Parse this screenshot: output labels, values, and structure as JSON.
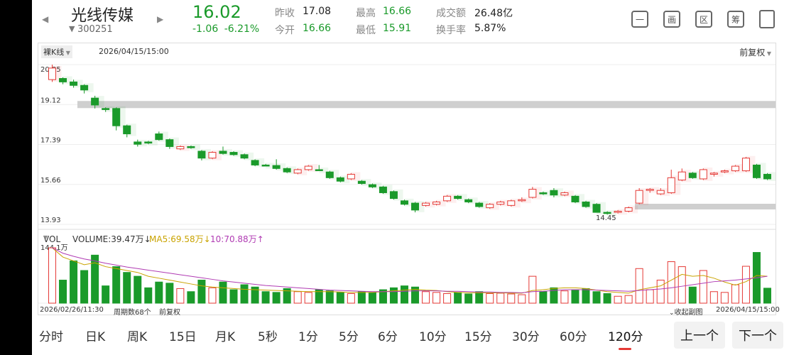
{
  "header": {
    "name": "光线传媒",
    "code": "300251",
    "price": "16.02",
    "change": "-1.06",
    "change_pct": "-6.21%",
    "stats": [
      {
        "label": "昨收",
        "value": "17.08",
        "color": "dark"
      },
      {
        "label": "今开",
        "value": "16.66",
        "color": "green"
      },
      {
        "label": "最高",
        "value": "16.66",
        "color": "green"
      },
      {
        "label": "最低",
        "value": "15.91",
        "color": "green"
      },
      {
        "label": "成交额",
        "value": "26.48亿",
        "color": "dark"
      },
      {
        "label": "换手率",
        "value": "5.87%",
        "color": "dark"
      }
    ],
    "tools": [
      "一",
      "画",
      "区",
      "筹"
    ]
  },
  "chart_top": {
    "mode": "裸K线",
    "timestamp": "2026/04/15/15:00",
    "adjust": "前复权"
  },
  "vol_info": {
    "mode": "VOL",
    "volume": "VOLUME:39.47万↓",
    "ma5": "MA5:69.58万↓",
    "ma10": "10:70.88万↑"
  },
  "bottom_labels": {
    "start": "2026/02/26/11:30",
    "period": "周期数68个",
    "adjust": "前复权",
    "collapse": "收起副图",
    "end": "2026/04/15/15:00"
  },
  "chart_data": {
    "type": "candlestick",
    "y_ticks": [
      "20.85",
      "19.12",
      "17.39",
      "15.66",
      "13.93"
    ],
    "ylim": [
      13.93,
      20.85
    ],
    "low_label": "14.45",
    "vol_max_label": "144.1万",
    "vol_max": 144.1,
    "candles": [
      {
        "o": 20.2,
        "c": 20.7,
        "h": 20.85,
        "l": 20.1,
        "v": 144
      },
      {
        "o": 20.25,
        "c": 20.1,
        "h": 20.3,
        "l": 20.0,
        "v": 60
      },
      {
        "o": 20.1,
        "c": 19.95,
        "h": 20.2,
        "l": 19.85,
        "v": 110
      },
      {
        "o": 19.95,
        "c": 19.75,
        "h": 20.0,
        "l": 19.6,
        "v": 85
      },
      {
        "o": 19.4,
        "c": 19.1,
        "h": 19.5,
        "l": 18.95,
        "v": 125
      },
      {
        "o": 18.95,
        "c": 18.9,
        "h": 19.0,
        "l": 18.8,
        "v": 45
      },
      {
        "o": 18.95,
        "c": 18.2,
        "h": 19.0,
        "l": 18.0,
        "v": 95
      },
      {
        "o": 18.2,
        "c": 17.85,
        "h": 18.25,
        "l": 17.7,
        "v": 80
      },
      {
        "o": 17.5,
        "c": 17.4,
        "h": 17.6,
        "l": 17.3,
        "v": 70
      },
      {
        "o": 17.5,
        "c": 17.45,
        "h": 17.55,
        "l": 17.4,
        "v": 40
      },
      {
        "o": 17.85,
        "c": 17.6,
        "h": 17.95,
        "l": 17.55,
        "v": 55
      },
      {
        "o": 17.6,
        "c": 17.3,
        "h": 17.65,
        "l": 17.2,
        "v": 52
      },
      {
        "o": 17.2,
        "c": 17.3,
        "h": 17.35,
        "l": 17.15,
        "v": 38
      },
      {
        "o": 17.3,
        "c": 17.25,
        "h": 17.35,
        "l": 17.2,
        "v": 30
      },
      {
        "o": 17.1,
        "c": 16.8,
        "h": 17.15,
        "l": 16.7,
        "v": 60
      },
      {
        "o": 16.8,
        "c": 17.05,
        "h": 17.1,
        "l": 16.75,
        "v": 40
      },
      {
        "o": 17.1,
        "c": 17.0,
        "h": 17.3,
        "l": 16.95,
        "v": 55
      },
      {
        "o": 17.05,
        "c": 16.95,
        "h": 17.1,
        "l": 16.9,
        "v": 35
      },
      {
        "o": 16.95,
        "c": 16.8,
        "h": 17.0,
        "l": 16.75,
        "v": 48
      },
      {
        "o": 16.7,
        "c": 16.5,
        "h": 16.75,
        "l": 16.45,
        "v": 42
      },
      {
        "o": 16.5,
        "c": 16.48,
        "h": 16.55,
        "l": 16.45,
        "v": 30
      },
      {
        "o": 16.48,
        "c": 16.35,
        "h": 16.75,
        "l": 16.3,
        "v": 28
      },
      {
        "o": 16.35,
        "c": 16.2,
        "h": 16.4,
        "l": 16.15,
        "v": 38
      },
      {
        "o": 16.15,
        "c": 16.3,
        "h": 16.35,
        "l": 16.1,
        "v": 30
      },
      {
        "o": 16.3,
        "c": 16.45,
        "h": 16.5,
        "l": 16.25,
        "v": 28
      },
      {
        "o": 16.3,
        "c": 16.3,
        "h": 16.5,
        "l": 16.25,
        "v": 35
      },
      {
        "o": 16.2,
        "c": 15.95,
        "h": 16.25,
        "l": 15.9,
        "v": 32
      },
      {
        "o": 15.95,
        "c": 15.8,
        "h": 16.0,
        "l": 15.75,
        "v": 28
      },
      {
        "o": 15.9,
        "c": 16.1,
        "h": 16.15,
        "l": 15.85,
        "v": 25
      },
      {
        "o": 15.8,
        "c": 15.7,
        "h": 15.85,
        "l": 15.65,
        "v": 30
      },
      {
        "o": 15.65,
        "c": 15.55,
        "h": 15.7,
        "l": 15.5,
        "v": 28
      },
      {
        "o": 15.55,
        "c": 15.3,
        "h": 15.6,
        "l": 15.25,
        "v": 35
      },
      {
        "o": 15.35,
        "c": 15.05,
        "h": 15.4,
        "l": 15.0,
        "v": 40
      },
      {
        "o": 14.95,
        "c": 14.8,
        "h": 15.0,
        "l": 14.75,
        "v": 45
      },
      {
        "o": 14.85,
        "c": 14.55,
        "h": 14.9,
        "l": 14.45,
        "v": 42
      },
      {
        "o": 14.75,
        "c": 14.85,
        "h": 14.9,
        "l": 14.7,
        "v": 30
      },
      {
        "o": 14.8,
        "c": 14.9,
        "h": 14.95,
        "l": 14.75,
        "v": 28
      },
      {
        "o": 14.95,
        "c": 15.15,
        "h": 15.2,
        "l": 14.9,
        "v": 25
      },
      {
        "o": 15.15,
        "c": 15.05,
        "h": 15.2,
        "l": 15.0,
        "v": 28
      },
      {
        "o": 15.0,
        "c": 14.9,
        "h": 15.05,
        "l": 14.85,
        "v": 24
      },
      {
        "o": 14.85,
        "c": 14.7,
        "h": 14.9,
        "l": 14.65,
        "v": 30
      },
      {
        "o": 14.65,
        "c": 14.8,
        "h": 14.85,
        "l": 14.6,
        "v": 25
      },
      {
        "o": 14.8,
        "c": 14.9,
        "h": 14.95,
        "l": 14.75,
        "v": 26
      },
      {
        "o": 14.75,
        "c": 14.95,
        "h": 15.0,
        "l": 14.7,
        "v": 24
      },
      {
        "o": 14.95,
        "c": 15.0,
        "h": 15.1,
        "l": 14.9,
        "v": 22
      },
      {
        "o": 15.1,
        "c": 15.45,
        "h": 15.55,
        "l": 15.05,
        "v": 70
      },
      {
        "o": 15.3,
        "c": 15.25,
        "h": 15.35,
        "l": 15.2,
        "v": 30
      },
      {
        "o": 15.4,
        "c": 15.2,
        "h": 15.5,
        "l": 15.1,
        "v": 40
      },
      {
        "o": 15.2,
        "c": 15.3,
        "h": 15.35,
        "l": 15.15,
        "v": 32
      },
      {
        "o": 15.15,
        "c": 14.9,
        "h": 15.2,
        "l": 14.85,
        "v": 35
      },
      {
        "o": 14.9,
        "c": 14.7,
        "h": 14.95,
        "l": 14.65,
        "v": 38
      },
      {
        "o": 14.8,
        "c": 14.45,
        "h": 14.85,
        "l": 14.45,
        "v": 30
      },
      {
        "o": 14.45,
        "c": 14.4,
        "h": 14.5,
        "l": 14.35,
        "v": 25
      },
      {
        "o": 14.45,
        "c": 14.5,
        "h": 14.55,
        "l": 14.4,
        "v": 18
      },
      {
        "o": 14.5,
        "c": 14.65,
        "h": 14.7,
        "l": 14.45,
        "v": 20
      },
      {
        "o": 14.85,
        "c": 15.4,
        "h": 15.5,
        "l": 14.8,
        "v": 90
      },
      {
        "o": 15.4,
        "c": 15.45,
        "h": 15.5,
        "l": 15.3,
        "v": 35
      },
      {
        "o": 15.25,
        "c": 15.4,
        "h": 15.5,
        "l": 15.2,
        "v": 60
      },
      {
        "o": 15.3,
        "c": 15.95,
        "h": 16.3,
        "l": 15.25,
        "v": 108
      },
      {
        "o": 15.85,
        "c": 16.2,
        "h": 16.35,
        "l": 15.8,
        "v": 95
      },
      {
        "o": 16.15,
        "c": 15.95,
        "h": 16.2,
        "l": 15.9,
        "v": 42
      },
      {
        "o": 15.9,
        "c": 16.3,
        "h": 16.35,
        "l": 15.85,
        "v": 85
      },
      {
        "o": 16.1,
        "c": 16.15,
        "h": 16.2,
        "l": 16.0,
        "v": 30
      },
      {
        "o": 16.2,
        "c": 16.25,
        "h": 16.3,
        "l": 16.15,
        "v": 28
      },
      {
        "o": 16.25,
        "c": 16.45,
        "h": 16.5,
        "l": 16.2,
        "v": 48
      },
      {
        "o": 16.25,
        "c": 16.8,
        "h": 16.85,
        "l": 16.2,
        "v": 96
      },
      {
        "o": 16.5,
        "c": 15.95,
        "h": 16.55,
        "l": 15.9,
        "v": 132
      },
      {
        "o": 16.1,
        "c": 15.9,
        "h": 16.15,
        "l": 15.85,
        "v": 39
      }
    ],
    "ma5_vol": [
      144,
      120,
      110,
      100,
      105,
      95,
      90,
      85,
      80,
      70,
      65,
      60,
      55,
      50,
      45,
      42,
      40,
      38,
      36,
      35,
      34,
      33,
      32,
      31,
      30,
      30,
      30,
      29,
      28,
      28,
      28,
      30,
      32,
      34,
      36,
      34,
      33,
      30,
      28,
      27,
      27,
      27,
      27,
      26,
      26,
      33,
      35,
      38,
      40,
      40,
      38,
      34,
      30,
      28,
      26,
      35,
      40,
      45,
      60,
      75,
      70,
      72,
      65,
      55,
      47,
      56,
      72,
      70
    ],
    "ma10_vol": [
      144,
      130,
      122,
      115,
      110,
      104,
      99,
      94,
      90,
      86,
      82,
      78,
      74,
      70,
      66,
      62,
      58,
      55,
      52,
      49,
      46,
      44,
      42,
      40,
      38,
      36,
      34,
      33,
      32,
      31,
      30,
      30,
      30,
      31,
      32,
      32,
      32,
      31,
      31,
      30,
      29,
      29,
      28,
      28,
      27,
      30,
      31,
      33,
      35,
      35,
      35,
      34,
      33,
      32,
      31,
      33,
      35,
      37,
      40,
      44,
      48,
      52,
      56,
      58,
      60,
      63,
      66,
      70
    ]
  }
}
